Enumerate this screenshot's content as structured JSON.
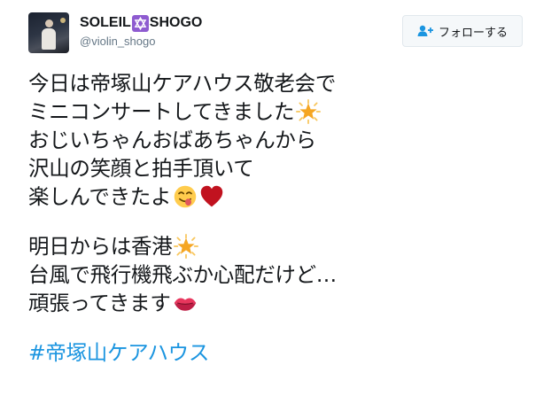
{
  "user": {
    "name_part1": "SOLEIL",
    "name_part2": "SHOGO",
    "handle": "@violin_shogo"
  },
  "follow_button": {
    "label": "フォローする"
  },
  "tweet": {
    "lines": [
      "今日は帝塚山ケアハウス敬老会で",
      "ミニコンサートしてきました",
      "おじいちゃんおばあちゃんから",
      "沢山の笑顔と拍手頂いて",
      "楽しんできたよ",
      "明日からは香港",
      "台風で飛行機飛ぶか心配だけど…",
      "頑張ってきます"
    ],
    "hashtag": "#帝塚山ケアハウス"
  },
  "colors": {
    "link": "#1b95e0",
    "star_of_david_bg": "#8e5bd0",
    "text": "#14171a",
    "muted": "#657786"
  },
  "icons": [
    "star-of-david-icon",
    "add-user-icon",
    "glowing-star-icon",
    "yum-face-icon",
    "heart-icon",
    "kiss-lips-icon"
  ]
}
